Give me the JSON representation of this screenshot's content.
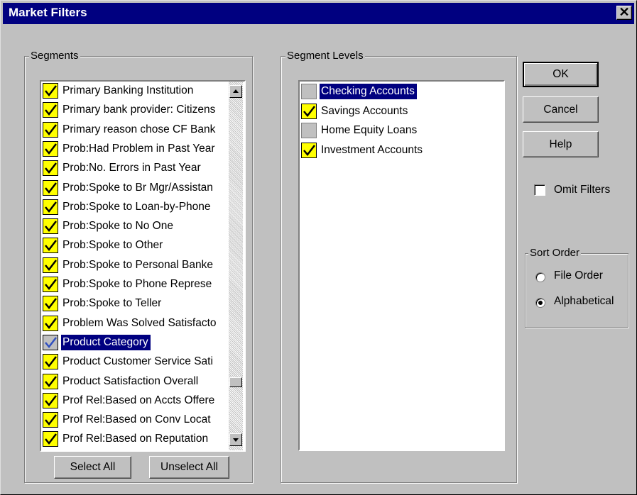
{
  "window": {
    "title": "Market Filters",
    "close_glyph": "✕"
  },
  "segments": {
    "label": "Segments",
    "items": [
      {
        "label": "Primary Banking Institution",
        "checked": true,
        "selected": false
      },
      {
        "label": "Primary bank provider: Citizens",
        "checked": true,
        "selected": false
      },
      {
        "label": "Primary reason chose CF Bank",
        "checked": true,
        "selected": false
      },
      {
        "label": "Prob:Had Problem in Past Year",
        "checked": true,
        "selected": false
      },
      {
        "label": "Prob:No. Errors in Past Year",
        "checked": true,
        "selected": false
      },
      {
        "label": "Prob:Spoke to Br Mgr/Assistan",
        "checked": true,
        "selected": false
      },
      {
        "label": "Prob:Spoke to Loan-by-Phone",
        "checked": true,
        "selected": false
      },
      {
        "label": "Prob:Spoke to No One",
        "checked": true,
        "selected": false
      },
      {
        "label": "Prob:Spoke to Other",
        "checked": true,
        "selected": false
      },
      {
        "label": "Prob:Spoke to Personal Banke",
        "checked": true,
        "selected": false
      },
      {
        "label": "Prob:Spoke to Phone Represe",
        "checked": true,
        "selected": false
      },
      {
        "label": "Prob:Spoke to Teller",
        "checked": true,
        "selected": false
      },
      {
        "label": "Problem Was Solved Satisfacto",
        "checked": true,
        "selected": false
      },
      {
        "label": "Product Category",
        "checked": true,
        "selected": true
      },
      {
        "label": "Product Customer Service Sati",
        "checked": true,
        "selected": false
      },
      {
        "label": "Product Satisfaction Overall",
        "checked": true,
        "selected": false
      },
      {
        "label": "Prof Rel:Based on Accts Offere",
        "checked": true,
        "selected": false
      },
      {
        "label": "Prof Rel:Based on Conv Locat",
        "checked": true,
        "selected": false
      },
      {
        "label": "Prof Rel:Based on Reputation",
        "checked": true,
        "selected": false
      }
    ],
    "select_all_label": "Select All",
    "unselect_all_label": "Unselect All"
  },
  "segment_levels": {
    "label": "Segment Levels",
    "items": [
      {
        "label": "Checking Accounts",
        "checked": false,
        "selected": true
      },
      {
        "label": "Savings Accounts",
        "checked": true,
        "selected": false
      },
      {
        "label": "Home Equity Loans",
        "checked": false,
        "selected": false
      },
      {
        "label": "Investment Accounts",
        "checked": true,
        "selected": false
      }
    ]
  },
  "buttons": {
    "ok": "OK",
    "cancel": "Cancel",
    "help": "Help"
  },
  "omit_filters": {
    "label": "Omit Filters",
    "checked": false
  },
  "sort_order": {
    "label": "Sort Order",
    "options": [
      {
        "label": "File Order",
        "selected": false
      },
      {
        "label": "Alphabetical",
        "selected": true
      }
    ]
  },
  "colors": {
    "title_bar": "#000080",
    "selection": "#000080",
    "checkbox_yellow": "#ffff00",
    "face": "#c0c0c0"
  }
}
